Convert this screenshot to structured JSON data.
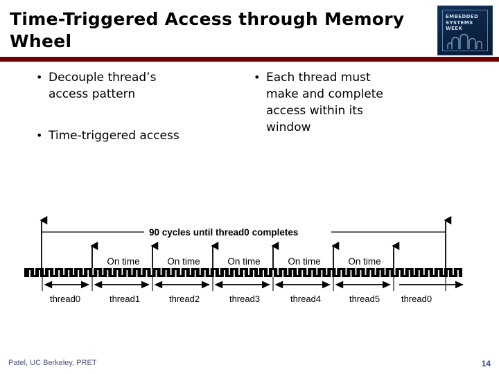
{
  "slide": {
    "title": "Time-Triggered Access through Memory\nWheel",
    "accent_color": "#6e0000",
    "background": "#ffffff"
  },
  "logo": {
    "text": "EMBEDDED\nSYSTEMS\nWEEK",
    "background": "#0d2545",
    "border_color": "#5e86b5"
  },
  "content": {
    "left_column": [
      {
        "bullet": "•",
        "text": "Decouple thread’s\naccess pattern"
      },
      {
        "bullet": "•",
        "text": "Time-triggered access"
      }
    ],
    "right_column": [
      {
        "bullet": "•",
        "text": "Each thread must\nmake and complete\naccess within its\nwindow"
      }
    ]
  },
  "diagram": {
    "span_label": "90 cycles until thread0 completes",
    "on_time_label": "On time",
    "on_time_count": 5,
    "thread_labels": [
      "thread0",
      "thread1",
      "thread2",
      "thread3",
      "thread4",
      "thread5",
      "thread0"
    ],
    "timeline_color": "#000000",
    "tick_count": 90
  },
  "footer": {
    "credit": "Patel, UC Berkeley, PRET",
    "page_number": "14",
    "text_color": "#4b4f7a"
  }
}
